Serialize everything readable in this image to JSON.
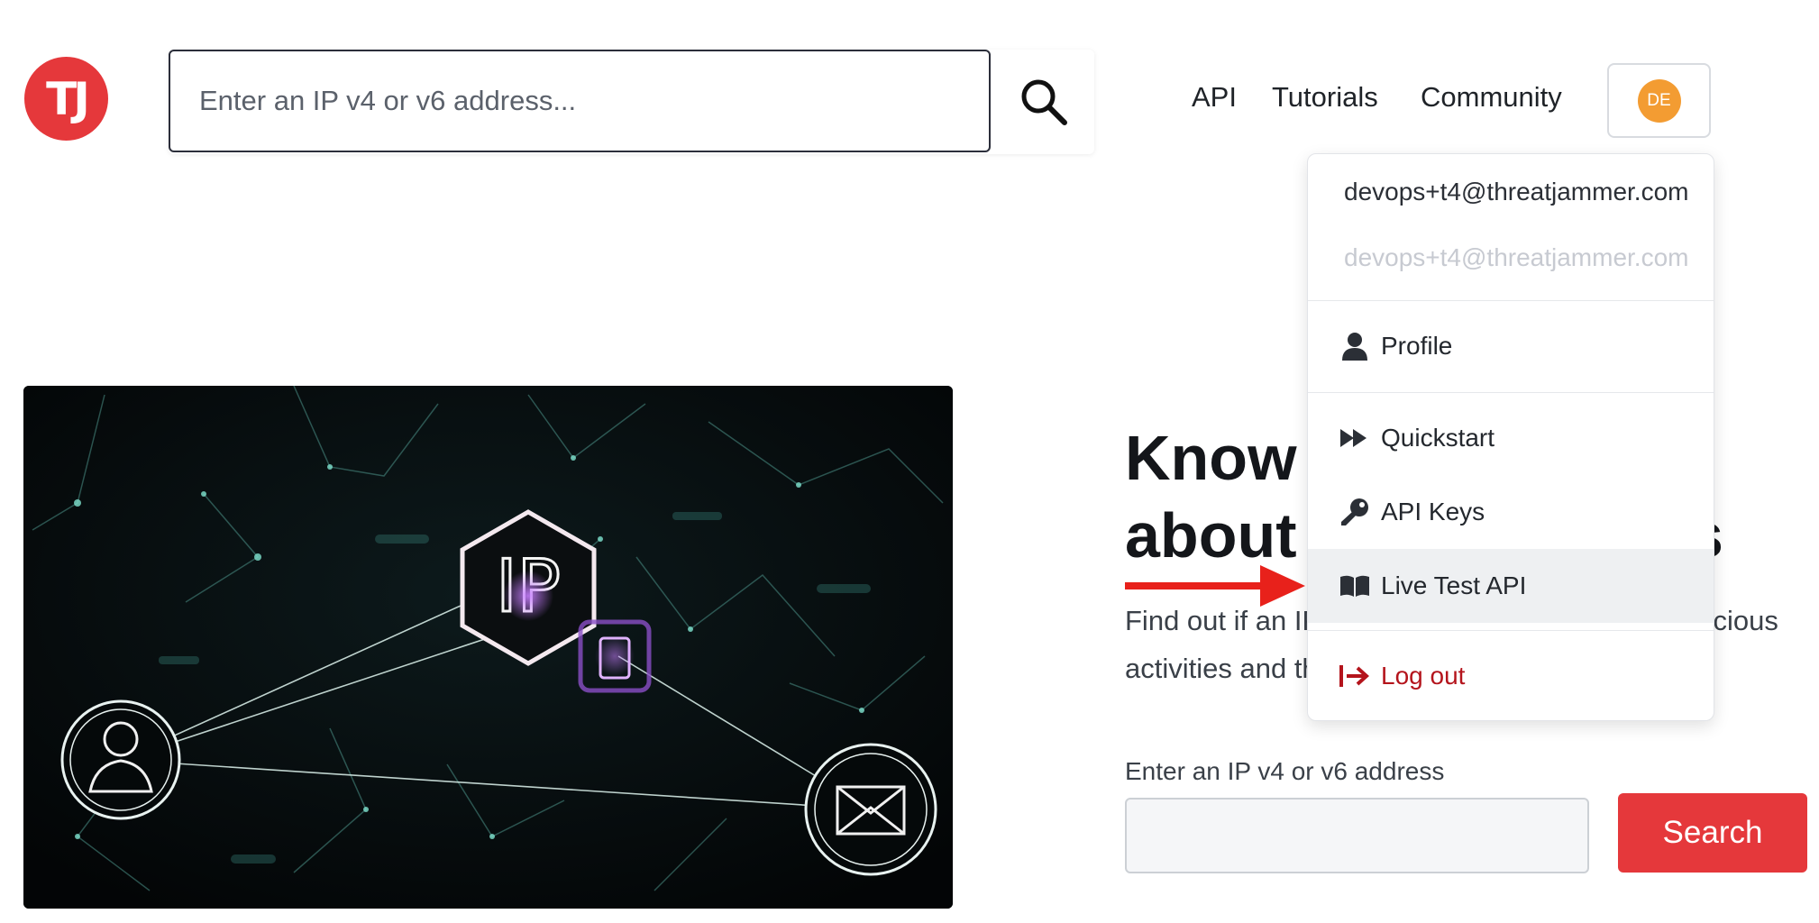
{
  "header": {
    "logo_text": "TJ",
    "search_placeholder": "Enter an IP v4 or v6 address...",
    "nav": [
      {
        "label": "API"
      },
      {
        "label": "Tutorials"
      },
      {
        "label": "Community"
      }
    ],
    "avatar_initials": "DE"
  },
  "hero": {
    "image_label": "IP",
    "title": "Know everything about an IP address",
    "subtitle": "Find out if an IP address is associated with malicious activities and threats",
    "form_label": "Enter an IP v4 or v6 address",
    "input_value": "",
    "search_button": "Search"
  },
  "dropdown": {
    "email_primary": "devops+t4@threatjammer.com",
    "email_secondary": "devops+t4@threatjammer.com",
    "items": [
      {
        "label": "Profile",
        "icon": "user-icon"
      },
      {
        "label": "Quickstart",
        "icon": "fast-forward-icon"
      },
      {
        "label": "API Keys",
        "icon": "key-icon"
      },
      {
        "label": "Live Test API",
        "icon": "book-icon"
      },
      {
        "label": "Log out",
        "icon": "logout-icon"
      }
    ],
    "active_item": "Live Test API"
  },
  "colors": {
    "brand_red": "#e5383b",
    "avatar_orange": "#f39c32",
    "logout_red": "#b4141c",
    "annotation_arrow": "#e8211b"
  }
}
